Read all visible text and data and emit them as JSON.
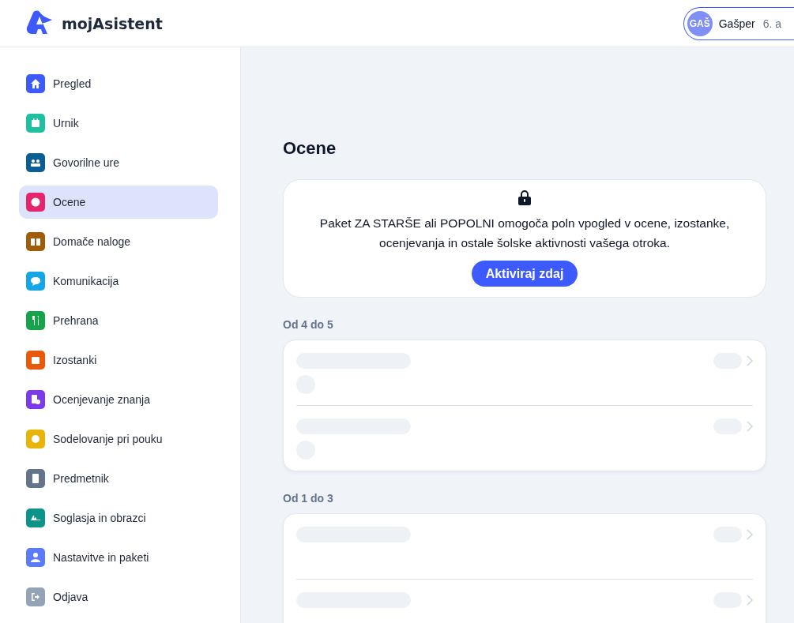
{
  "app": {
    "name": "mojAsistent"
  },
  "user": {
    "initials": "GAŠ",
    "name": "Gašper",
    "class": "6. a"
  },
  "sidebar": {
    "items": [
      {
        "label": "Pregled",
        "color": "#3d5afe",
        "selected": false
      },
      {
        "label": "Urnik",
        "color": "#1fbfa0",
        "selected": false
      },
      {
        "label": "Govorilne ure",
        "color": "#0b5e94",
        "selected": false
      },
      {
        "label": "Ocene",
        "color": "#e5246e",
        "selected": true
      },
      {
        "label": "Domače naloge",
        "color": "#a15c07",
        "selected": false
      },
      {
        "label": "Komunikacija",
        "color": "#13a5e6",
        "selected": false
      },
      {
        "label": "Prehrana",
        "color": "#17a34a",
        "selected": false
      },
      {
        "label": "Izostanki",
        "color": "#ea580c",
        "selected": false
      },
      {
        "label": "Ocenjevanje znanja",
        "color": "#7c3aed",
        "selected": false
      },
      {
        "label": "Sodelovanje pri pouku",
        "color": "#eab308",
        "selected": false
      },
      {
        "label": "Predmetnik",
        "color": "#64748b",
        "selected": false
      },
      {
        "label": "Soglasja in obrazci",
        "color": "#0d9488",
        "selected": false
      },
      {
        "label": "Nastavitve in paketi",
        "color": "#5b7cfa",
        "selected": false
      },
      {
        "label": "Odjava",
        "color": "#94a3b8",
        "selected": false
      }
    ]
  },
  "page": {
    "title": "Ocene"
  },
  "notice": {
    "text": "Paket ZA STARŠE ali POPOLNI omogoča poln vpogled v ocene, izostanke, ocenjevanja in ostale šolske aktivnosti vašega otroka.",
    "button": "Aktiviraj zdaj"
  },
  "groups": [
    {
      "title": "Od 4 do 5",
      "rows": [
        {
          "badge": true
        },
        {
          "badge": true
        }
      ]
    },
    {
      "title": "Od 1 do 3",
      "rows": [
        {
          "badge": false
        },
        {
          "badge": false
        }
      ]
    }
  ]
}
